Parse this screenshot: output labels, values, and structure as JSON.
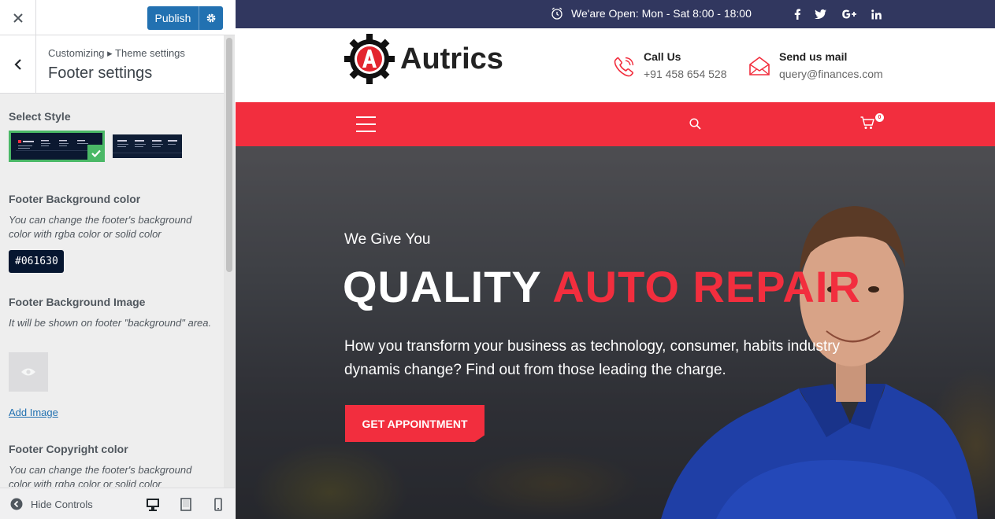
{
  "customizer": {
    "publish_label": "Publish",
    "breadcrumb": "Customizing ▸ Theme settings",
    "section_title": "Footer settings",
    "select_style_label": "Select Style",
    "bg_color_title": "Footer Background color",
    "bg_color_desc": "You can change the footer's background color with rgba color or solid color",
    "bg_color_value": "#061630",
    "bg_image_title": "Footer Background Image",
    "bg_image_desc": "It will be shown on footer \"background\" area.",
    "add_image_label": "Add Image",
    "copyright_color_title": "Footer Copyright color",
    "copyright_color_desc": "You can change the footer's background color with rgba color or solid color",
    "hide_controls_label": "Hide Controls",
    "accent_color": "#2271b1",
    "selected_color": "#4ab866"
  },
  "site": {
    "topbar": {
      "open_hours": "We'are Open: Mon - Sat 8:00 - 18:00",
      "social": [
        "facebook-icon",
        "twitter-icon",
        "google-plus-icon",
        "linkedin-icon"
      ]
    },
    "logo_text": "Autrics",
    "contacts": [
      {
        "title": "Call Us",
        "value": "+91 458 654 528"
      },
      {
        "title": "Send us mail",
        "value": "query@finances.com"
      }
    ],
    "cart_count": "0",
    "hero": {
      "subtitle": "We Give You",
      "title_main": "QUALITY ",
      "title_accent": "AUTO REPAIR",
      "description": "How you transform your business as technology, consumer, habits industry dynamis change? Find out from those leading the charge.",
      "cta_label": "GET APPOINTMENT"
    },
    "brand_color": "#f22e3e",
    "topbar_color": "#31375f"
  }
}
